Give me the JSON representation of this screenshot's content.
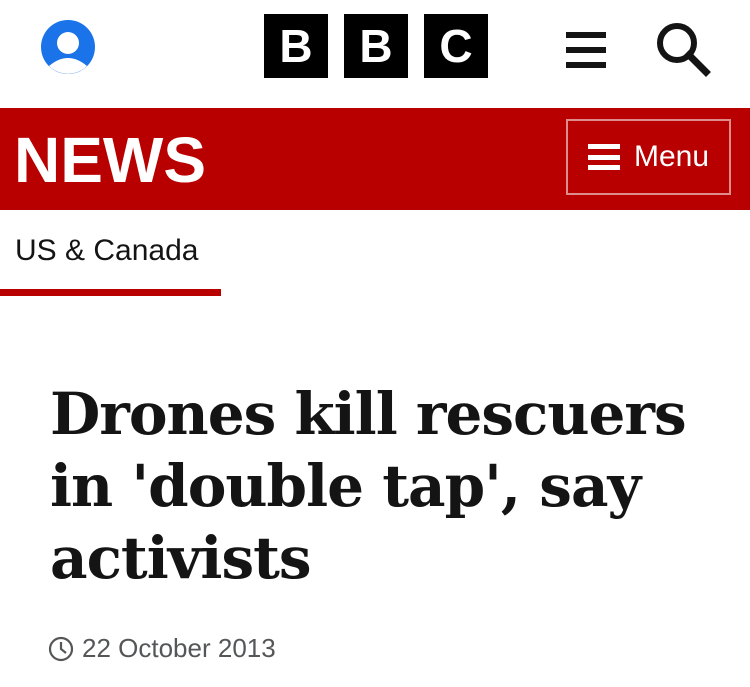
{
  "header": {
    "logo_letters": [
      "B",
      "B",
      "C"
    ],
    "account_icon": "account-icon",
    "menu_icon": "hamburger-icon",
    "search_icon": "search-icon"
  },
  "news_bar": {
    "title": "NEWS",
    "menu_label": "Menu",
    "background_color": "#b80000"
  },
  "section": {
    "label": "US & Canada"
  },
  "article": {
    "headline": "Drones kill rescuers in 'double tap', say activists",
    "date": "22 October 2013"
  }
}
